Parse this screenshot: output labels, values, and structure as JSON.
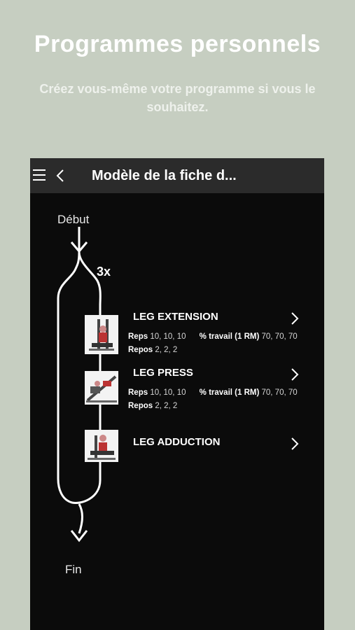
{
  "hero": {
    "title": "Programmes personnels",
    "subtitle": "Créez vous-même votre programme si vous le souhaitez."
  },
  "app": {
    "title": "Modèle de la fiche d...",
    "menu_icon": "hamburger-menu-icon",
    "back_icon": "chevron-left-icon"
  },
  "flow": {
    "start_label": "Début",
    "end_label": "Fin",
    "loop_count": "3x"
  },
  "exercises": [
    {
      "name": "LEG EXTENSION",
      "reps_label": "Reps",
      "reps": "10, 10, 10",
      "work_label": "% travail (1 RM)",
      "work": "70, 70, 70",
      "rest_label": "Repos",
      "rest": "2, 2, 2"
    },
    {
      "name": "LEG PRESS",
      "reps_label": "Reps",
      "reps": "10, 10, 10",
      "work_label": "% travail (1 RM)",
      "work": "70, 70, 70",
      "rest_label": "Repos",
      "rest": "2, 2, 2"
    },
    {
      "name": "LEG ADDUCTION"
    }
  ],
  "colors": {
    "page_bg": "#c6cec1",
    "phone_bg": "#0b0b0b",
    "appbar_bg": "#2b2b2b",
    "text": "#ffffff"
  }
}
